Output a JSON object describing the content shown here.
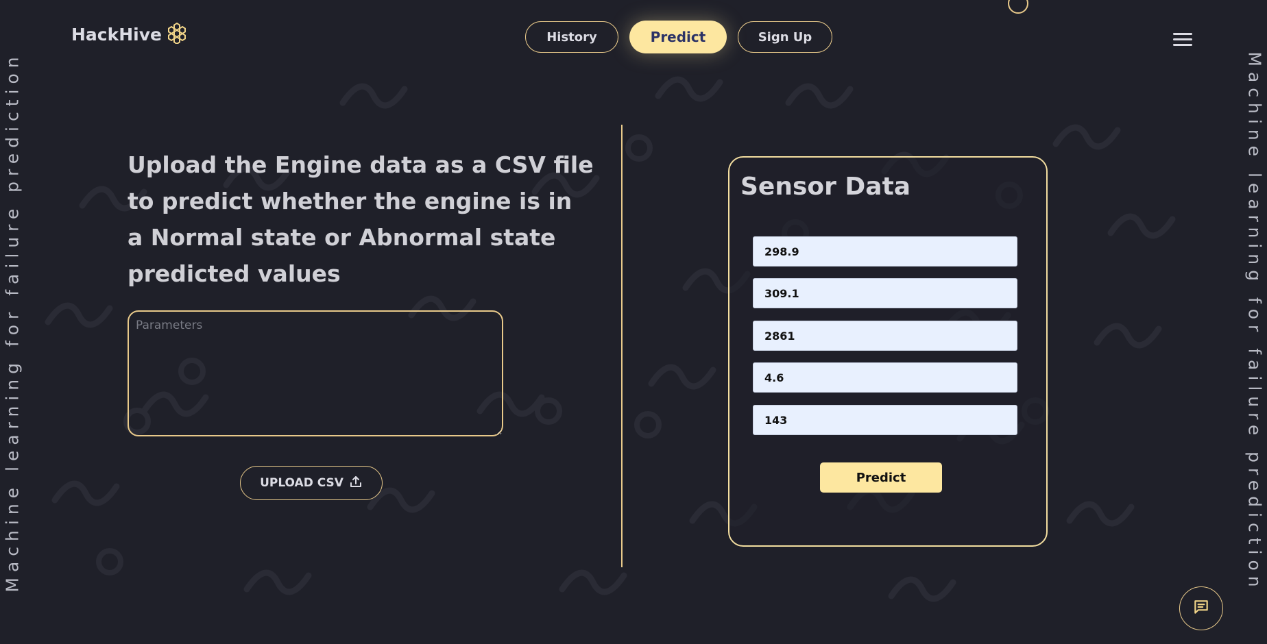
{
  "brand": {
    "name": "HackHive",
    "accent": "#fde7a0",
    "border": "#e8c98a"
  },
  "side_text": "Machine learning for failure prediction",
  "nav": {
    "history": "History",
    "predict": "Predict",
    "signup": "Sign Up"
  },
  "headline": "Upload the Engine data as a CSV file to predict whether the engine is in a Normal state or Abnormal state predicted values",
  "params_placeholder": "Parameters",
  "upload_label": "UPLOAD CSV",
  "card": {
    "title": "Sensor Data",
    "values": [
      "298.9",
      "309.1",
      "2861",
      "4.6",
      "143"
    ],
    "button": "Predict"
  },
  "icons": [
    "honeycomb-logo-icon",
    "upload-icon",
    "hamburger-menu-icon",
    "chat-icon"
  ]
}
